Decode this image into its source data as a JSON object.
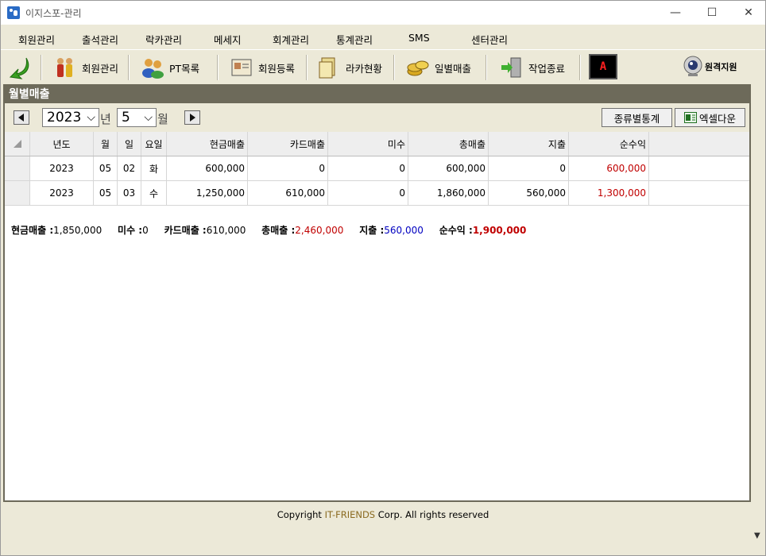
{
  "window": {
    "title": "이지스포-관리",
    "min_glyph": "—",
    "max_glyph": "☐",
    "close_glyph": "✕"
  },
  "menu": [
    "회원관리",
    "출석관리",
    "락카관리",
    "메세지",
    "회계관리",
    "통계관리",
    "SMS",
    "센터관리"
  ],
  "toolbar": {
    "member_mgmt": "회원관리",
    "pt_list": "PT목록",
    "member_register": "회원등록",
    "locker_status": "라카현황",
    "daily_sales": "일별매출",
    "work_end": "작업종료",
    "badge": "A",
    "remote_support": "원격지원"
  },
  "panel": {
    "title": "월별매출",
    "year": "2023",
    "year_unit": "년",
    "month": "5",
    "month_unit": "월",
    "type_stats_button": "종류별통계",
    "excel_button": "엑셀다운"
  },
  "table": {
    "headers": [
      "년도",
      "월",
      "일",
      "요일",
      "현금매출",
      "카드매출",
      "미수",
      "총매출",
      "지출",
      "순수익"
    ],
    "rows": [
      [
        "2023",
        "05",
        "02",
        "화",
        "600,000",
        "0",
        "0",
        "600,000",
        "0",
        "600,000"
      ],
      [
        "2023",
        "05",
        "03",
        "수",
        "1,250,000",
        "610,000",
        "0",
        "1,860,000",
        "560,000",
        "1,300,000"
      ]
    ]
  },
  "summary": {
    "cash_label": "현금매출 :",
    "cash_value": "1,850,000",
    "unpaid_label": "미수 :",
    "unpaid_value": "0",
    "card_label": "카드매출 :",
    "card_value": "610,000",
    "total_label": "총매출 :",
    "total_value": "2,460,000",
    "expense_label": "지출 :",
    "expense_value": "560,000",
    "profit_label": "순수익 :",
    "profit_value": "1,900,000"
  },
  "footer": {
    "prefix": "Copyright ",
    "brand": "IT-FRIENDS",
    "suffix": " Corp. All rights reserved"
  },
  "colors": {
    "panel_header": "#6d6a5a",
    "profit_red": "#c00000",
    "expense_blue": "#0000c0"
  }
}
